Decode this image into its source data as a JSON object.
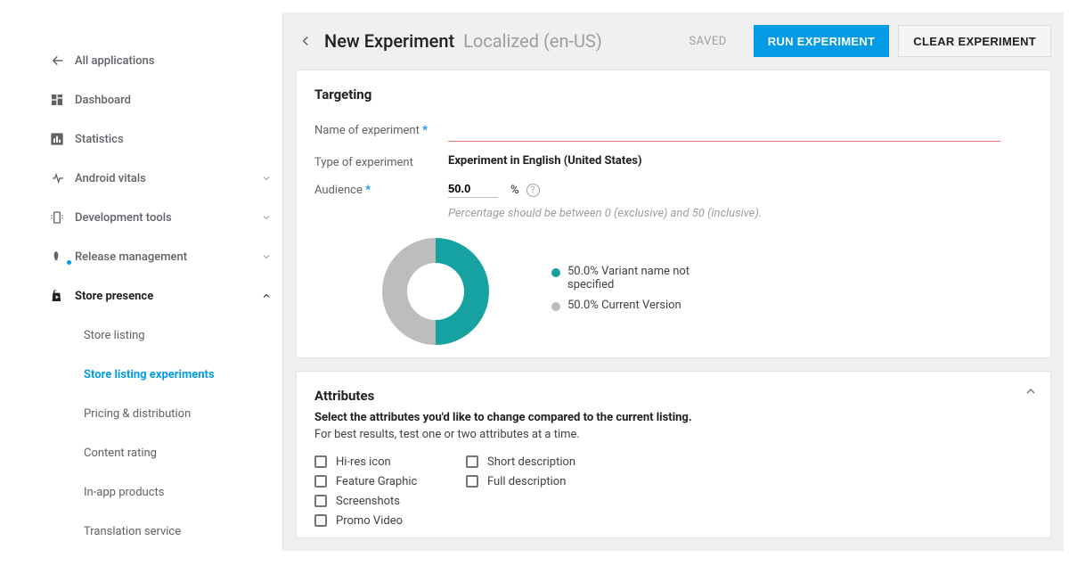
{
  "sidebar": {
    "all_apps_label": "All applications",
    "items": [
      {
        "label": "Dashboard"
      },
      {
        "label": "Statistics"
      },
      {
        "label": "Android vitals"
      },
      {
        "label": "Development tools"
      },
      {
        "label": "Release management"
      },
      {
        "label": "Store presence"
      }
    ],
    "store_presence_subitems": [
      {
        "label": "Store listing"
      },
      {
        "label": "Store listing experiments"
      },
      {
        "label": "Pricing & distribution"
      },
      {
        "label": "Content rating"
      },
      {
        "label": "In-app products"
      },
      {
        "label": "Translation service"
      }
    ]
  },
  "header": {
    "title": "New Experiment",
    "subtitle": "Localized (en-US)",
    "saved_label": "SAVED",
    "run_button": "RUN EXPERIMENT",
    "clear_button": "CLEAR EXPERIMENT"
  },
  "targeting": {
    "section_title": "Targeting",
    "name_label": "Name of experiment",
    "name_value": "",
    "type_label": "Type of experiment",
    "type_value": "Experiment in English (United States)",
    "audience_label": "Audience",
    "audience_value": "50.0",
    "percent_symbol": "%",
    "audience_hint": "Percentage should be between 0 (exclusive) and 50 (inclusive).",
    "legend_variant": "50.0% Variant name not specified",
    "legend_current": "50.0% Current Version"
  },
  "attributes": {
    "section_title": "Attributes",
    "help_bold": "Select the attributes you'd like to change compared to the current listing.",
    "help_plain": "For best results, test one or two attributes at a time.",
    "col1": [
      {
        "label": "Hi-res icon"
      },
      {
        "label": "Feature Graphic"
      },
      {
        "label": "Screenshots"
      },
      {
        "label": "Promo Video"
      }
    ],
    "col2": [
      {
        "label": "Short description"
      },
      {
        "label": "Full description"
      }
    ]
  },
  "chart_data": {
    "type": "pie",
    "title": "",
    "series": [
      {
        "name": "Variant name not specified",
        "value": 50.0,
        "color": "#17a2a2"
      },
      {
        "name": "Current Version",
        "value": 50.0,
        "color": "#bdbdbd"
      }
    ]
  }
}
